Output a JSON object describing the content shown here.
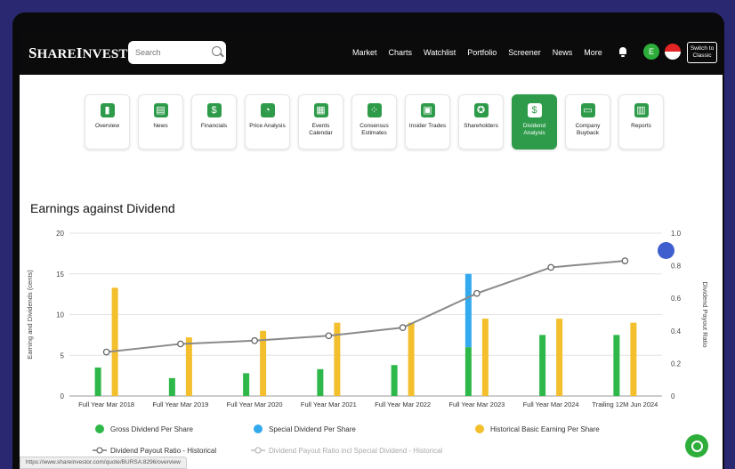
{
  "app": {
    "logo": "ShareInvestor",
    "search_placeholder": "Search",
    "menu": [
      "Market",
      "Charts",
      "Watchlist",
      "Portfolio",
      "Screener",
      "News",
      "More"
    ],
    "user_initial": "E",
    "switch_label": "Switch to Classic",
    "status_url": "https://www.shareinvestor.com/quote/BURSA:8296/overview"
  },
  "tiles": [
    {
      "label": "Overview",
      "icon": "bar-chart-icon"
    },
    {
      "label": "News",
      "icon": "newspaper-icon"
    },
    {
      "label": "Financials",
      "icon": "money-bag-icon"
    },
    {
      "label": "Price Analysis",
      "icon": "pie-chart-icon"
    },
    {
      "label": "Events Calendar",
      "icon": "calendar-icon"
    },
    {
      "label": "Consensus Estimates",
      "icon": "scatter-icon"
    },
    {
      "label": "Insider Trades",
      "icon": "presentation-icon"
    },
    {
      "label": "Shareholders",
      "icon": "medal-icon"
    },
    {
      "label": "Dividend Analysis",
      "icon": "hand-money-icon",
      "active": true
    },
    {
      "label": "Company Buyback",
      "icon": "cash-icon"
    },
    {
      "label": "Reports",
      "icon": "book-icon"
    }
  ],
  "chart_title": "Earnings against Dividend",
  "chart_data": {
    "type": "bar",
    "title": "Earnings against Dividend",
    "ylabel": "Earning and Dividends (cents)",
    "y2label": "Dividend Payout Ratio",
    "ylim": [
      0,
      20
    ],
    "y2lim": [
      0,
      1.0
    ],
    "yticks": [
      0,
      5,
      10,
      15,
      20
    ],
    "y2ticks": [
      "0",
      "0.2",
      "0.4",
      "0.6",
      "0.8",
      "1.0"
    ],
    "categories": [
      "Full Year Mar 2018",
      "Full Year Mar 2019",
      "Full Year Mar 2020",
      "Full Year Mar 2021",
      "Full Year Mar 2022",
      "Full Year Mar 2023",
      "Full Year Mar 2024",
      "Trailing 12M Jun 2024"
    ],
    "series": [
      {
        "name": "Gross Dividend Per Share",
        "color": "#2eb84a",
        "values": [
          3.5,
          2.2,
          2.8,
          3.3,
          3.8,
          6.0,
          7.5,
          7.5
        ]
      },
      {
        "name": "Special Dividend Per Share",
        "color": "#33aaee",
        "values": [
          0,
          0,
          0,
          0,
          0,
          9.0,
          0,
          0
        ]
      },
      {
        "name": "Historical Basic Earning Per Share",
        "color": "#f3bf2d",
        "values": [
          13.3,
          7.2,
          8.0,
          9.0,
          9.0,
          9.5,
          9.5,
          9.0
        ]
      },
      {
        "name": "Dividend Payout Ratio - Historical",
        "color": "#777777",
        "axis": "right",
        "values": [
          0.27,
          0.32,
          0.34,
          0.37,
          0.42,
          0.63,
          0.79,
          0.83
        ]
      },
      {
        "name": "Dividend Payout Ratio incl Special Dividend - Historical",
        "color": "#bbbbbb",
        "axis": "right",
        "values": []
      }
    ],
    "legend_position": "bottom"
  }
}
